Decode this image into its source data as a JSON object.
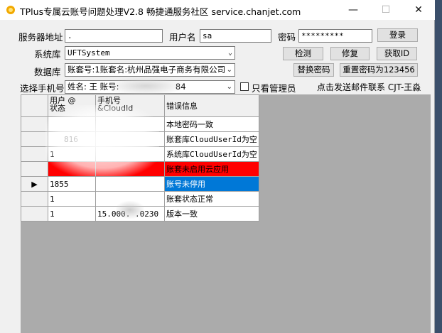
{
  "window": {
    "title": "TPlus专属云账号问题处理V2.8  畅捷通服务社区 service.chanjet.com",
    "min_glyph": "—",
    "max_glyph": "☐",
    "close_glyph": "✕"
  },
  "form": {
    "server_label": "服务器地址",
    "server_value": ".",
    "username_label": "用户名",
    "username_value": "sa",
    "password_label": "密码",
    "password_value": "*********",
    "login_button": "登录",
    "sysdb_label": "系统库",
    "sysdb_value": "UFTSystem",
    "check_button": "检测",
    "repair_button": "修复",
    "get_id_button": "获取ID",
    "database_label": "数据库",
    "database_value": "账套号:1账套名:杭州品强电子商务有限公司",
    "replace_pwd_button": "替换密码",
    "reset_pwd_button": "重置密码为123456",
    "phone_label": "选择手机号",
    "phone_value_prefix": "姓名: 王  账号:",
    "phone_value_suffix": "84",
    "admin_only_label": "只看管理员",
    "email_link": "点击发送邮件联系 CJT-王淼"
  },
  "grid": {
    "headers": {
      "col1_line1": "用户    @",
      "col1_line2": "状态",
      "col2_line1": "手机号",
      "col2_line2": "&CloudId",
      "col3": "错误信息"
    },
    "rows": [
      {
        "c1": "",
        "c2": "",
        "c3": "本地密码一致"
      },
      {
        "c1": "816",
        "c2": "",
        "c3": "账套库CloudUserId为空"
      },
      {
        "c1": "1",
        "c2": "",
        "c3": "系统库CloudUserId为空"
      },
      {
        "c1": "",
        "c2": "",
        "c3": "账套未启用云应用"
      },
      {
        "c1": "1855",
        "c2": "",
        "c3": "账号未停用"
      },
      {
        "c1": "1",
        "c2": "",
        "c3": "账套状态正常"
      },
      {
        "c1": "1",
        "c2": "15.000.  .0230",
        "c3": "版本一致"
      }
    ],
    "current_row_marker": "▶"
  },
  "colors": {
    "error_row": "#ff0000",
    "selected_cell": "#0078d7"
  }
}
